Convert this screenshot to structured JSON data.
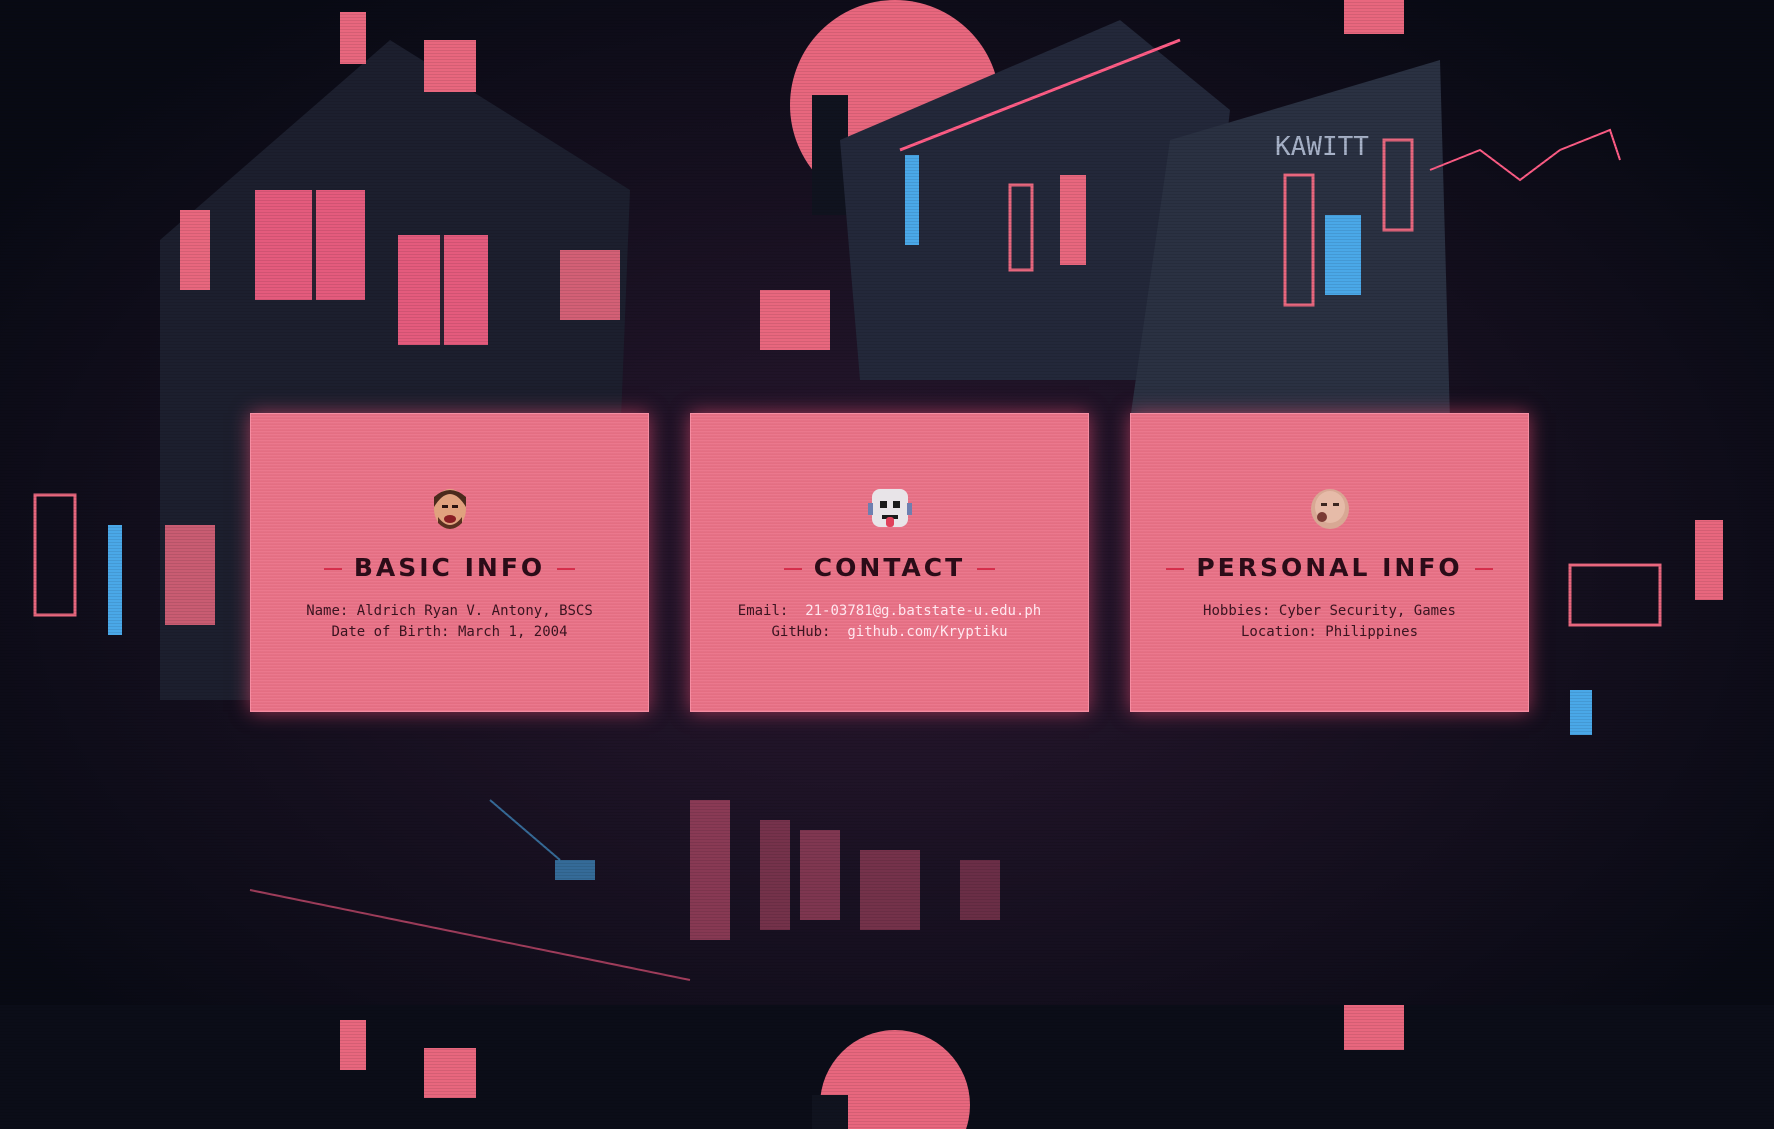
{
  "cards": [
    {
      "title": "BASIC INFO",
      "avatar_icon": "bearded-man-emoji",
      "lines": [
        {
          "label": "Name:",
          "value": "Aldrich Ryan V. Antony, BSCS"
        },
        {
          "label": "Date of Birth:",
          "value": "March 1, 2004"
        }
      ]
    },
    {
      "title": "CONTACT",
      "avatar_icon": "robot-tongue-emoji",
      "lines": [
        {
          "label": "Email:",
          "value": "21-03781@g.batstate-u.edu.ph"
        },
        {
          "label": "GitHub:",
          "value": "github.com/Kryptiku"
        }
      ]
    },
    {
      "title": "PERSONAL INFO",
      "avatar_icon": "baby-face-emoji",
      "lines": [
        {
          "label": "Hobbies:",
          "value": "Cyber Security, Games"
        },
        {
          "label": "Location:",
          "value": "Philippines"
        }
      ]
    }
  ],
  "background_signs": {
    "building_sign": "KAWITT"
  },
  "colors": {
    "card_bg": "#ea7086",
    "accent": "#d62e4c",
    "neon_pink": "#ff5d86",
    "neon_blue": "#4aa8e8",
    "night": "#0a0c16"
  }
}
